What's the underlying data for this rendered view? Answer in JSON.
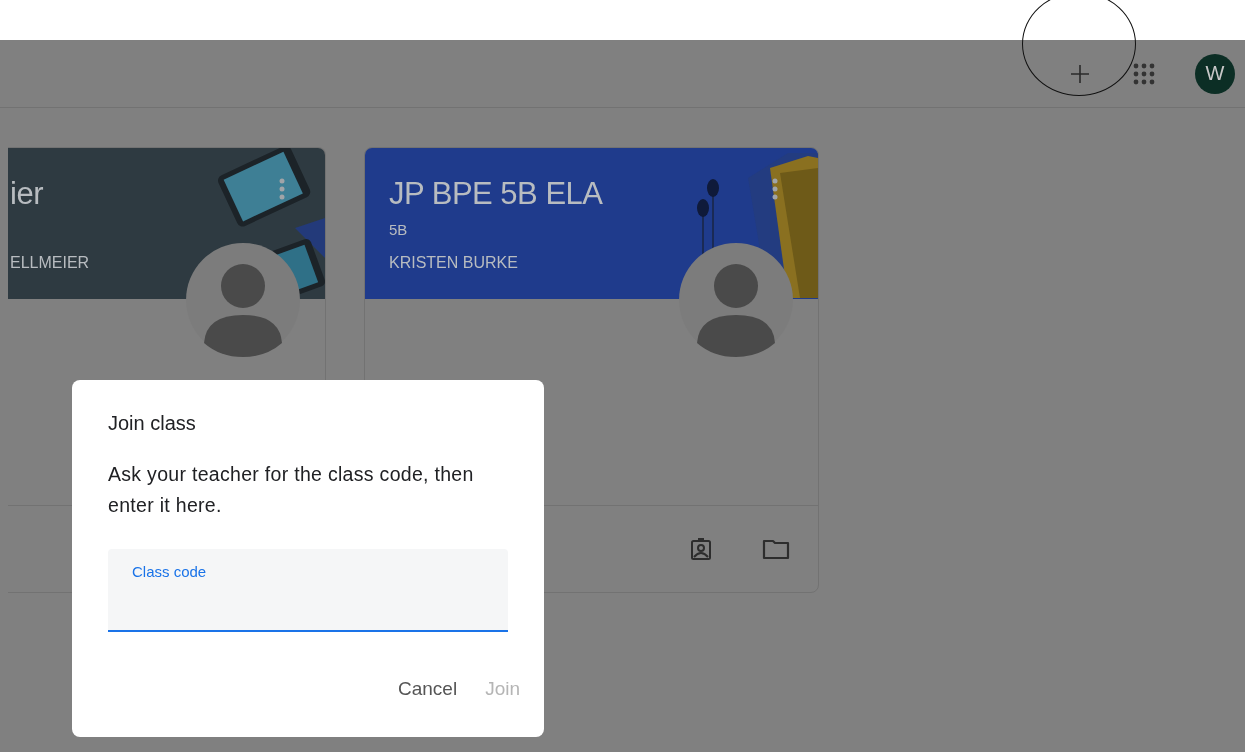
{
  "header": {
    "account_initial": "W",
    "add_highlighted": true
  },
  "classes": [
    {
      "title": "ier",
      "teacher": "ELLMEIER",
      "color": "#2e3a41",
      "kind": "tablets"
    },
    {
      "title": "JP BPE 5B ELA",
      "section": "5B",
      "teacher": "KRISTEN BURKE",
      "color": "#1f3b8c",
      "kind": "earbuds",
      "footer_icons": true
    }
  ],
  "dialog": {
    "title": "Join class",
    "text": "Ask your teacher for the class code, then enter it here.",
    "field": {
      "placeholder": "Class code",
      "focused": true
    },
    "buttons": [
      {
        "label": "Cancel",
        "disabled": false
      },
      {
        "label": "Join",
        "disabled": true
      }
    ]
  }
}
